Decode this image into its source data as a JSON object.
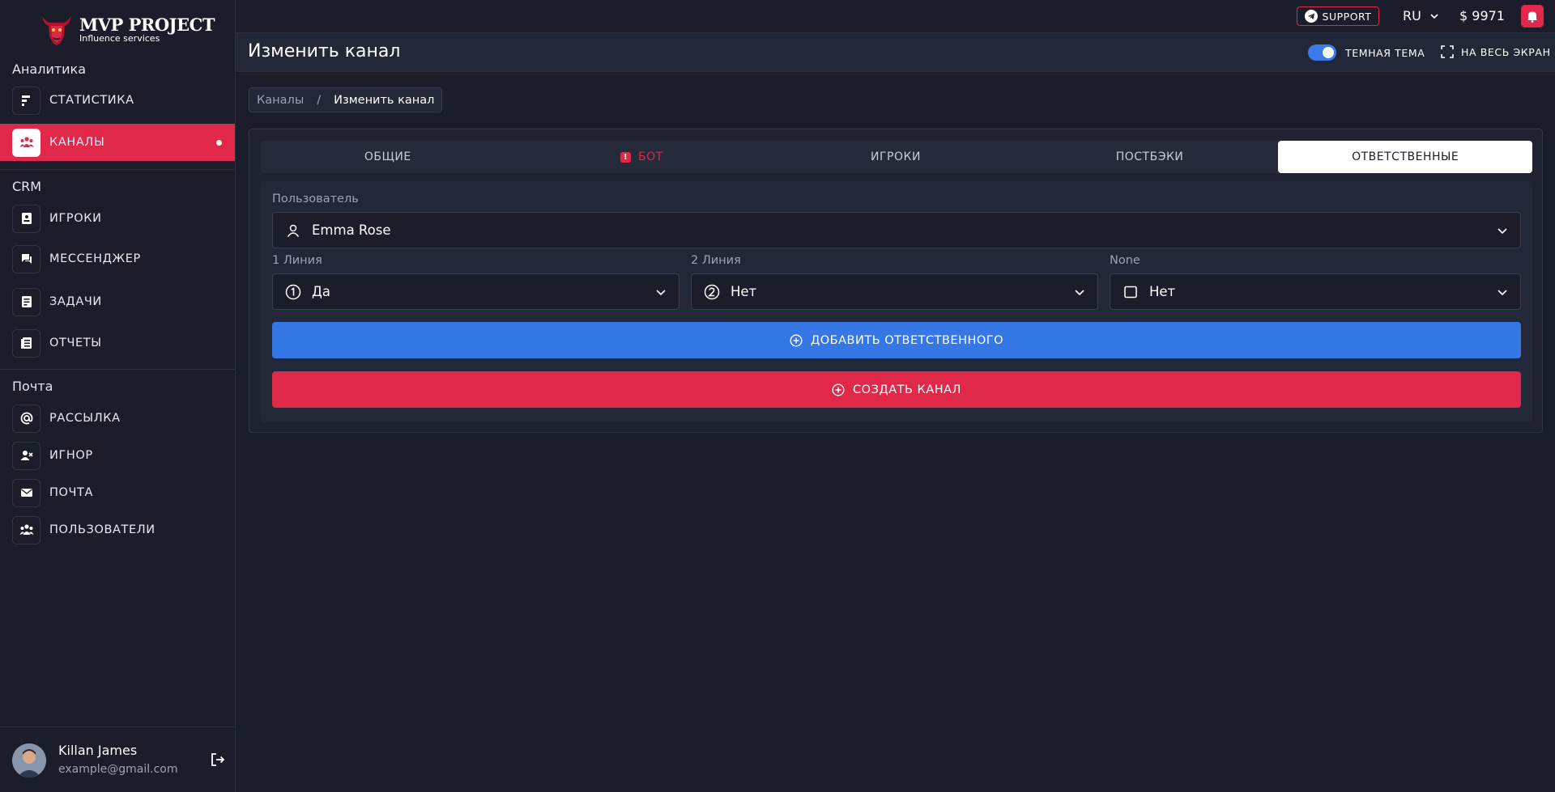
{
  "brand": {
    "title": "MVP PROJECT",
    "subtitle": "Influence services"
  },
  "sidebar": {
    "sections": [
      {
        "title": "Аналитика"
      },
      {
        "title": "CRM"
      },
      {
        "title": "Почта"
      }
    ],
    "items": [
      {
        "label": "СТАТИСТИКА",
        "icon": "bar-chart-icon"
      },
      {
        "label": "КАНАЛЫ",
        "icon": "users-icon",
        "active": true
      },
      {
        "label": "ИГРОКИ",
        "icon": "contacts-book-icon"
      },
      {
        "label": "МЕССЕНДЖЕР",
        "icon": "chat-icon"
      },
      {
        "label": "ЗАДАЧИ",
        "icon": "tasks-icon"
      },
      {
        "label": "ОТЧЕТЫ",
        "icon": "reports-icon"
      },
      {
        "label": "РАССЫЛКА",
        "icon": "at-sign-icon"
      },
      {
        "label": "ИГНОР",
        "icon": "user-x-icon"
      },
      {
        "label": "ПОЧТА",
        "icon": "mail-icon"
      },
      {
        "label": "ПОЛЬЗОВАТЕЛИ",
        "icon": "users-icon"
      }
    ],
    "user": {
      "name": "Killan James",
      "email": "example@gmail.com"
    }
  },
  "topbar": {
    "support_label": "SUPPORT",
    "language": "RU",
    "balance": "$ 9971"
  },
  "header": {
    "title": "Изменить канал",
    "theme_label": "ТЕМНАЯ ТЕМА",
    "theme_on": true,
    "fullscreen_label": "НА ВЕСЬ ЭКРАН"
  },
  "breadcrumb": {
    "parent": "Каналы",
    "separator": "/",
    "current": "Изменить канал"
  },
  "tabs": [
    {
      "label": "ОБЩИЕ"
    },
    {
      "label": "БОТ",
      "alert": "!"
    },
    {
      "label": "ИГРОКИ"
    },
    {
      "label": "ПОСТБЭКИ"
    },
    {
      "label": "ОТВЕТСТВЕННЫЕ",
      "active": true
    }
  ],
  "form": {
    "user_label": "Пользователь",
    "user_value": "Emma Rose",
    "line1_label": "1 Линия",
    "line1_value": "Да",
    "line2_label": "2 Линия",
    "line2_value": "Нет",
    "line3_label": "None",
    "line3_value": "Нет",
    "add_button": "ДОБАВИТЬ ОТВЕТСТВЕННОГО",
    "create_button": "СОЗДАТЬ КАНАЛ"
  },
  "colors": {
    "accent_red": "#e0284a",
    "accent_blue": "#3677e6",
    "background": "#1b1e2a",
    "panel": "#232838"
  }
}
